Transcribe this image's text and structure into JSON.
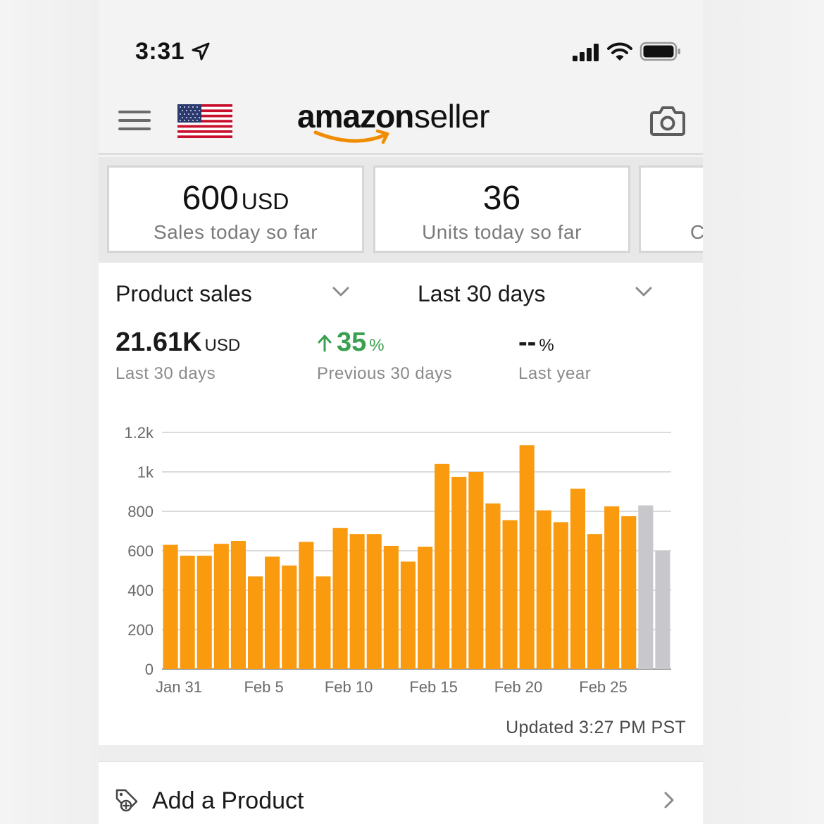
{
  "status_bar": {
    "time": "3:31"
  },
  "header": {
    "logo_amazon": "amazon",
    "logo_seller": "seller"
  },
  "cards": [
    {
      "value": "600",
      "unit": "USD",
      "label": "Sales today so far"
    },
    {
      "value": "36",
      "unit": "",
      "label": "Units today so far"
    },
    {
      "value": "",
      "unit": "",
      "label": "C"
    }
  ],
  "filters": {
    "metric": "Product sales",
    "period": "Last 30 days"
  },
  "stats": [
    {
      "value": "21.61K",
      "unit": "USD",
      "label": "Last 30 days"
    },
    {
      "value": "35",
      "unit": "%",
      "label": "Previous 30 days",
      "trend": "up"
    },
    {
      "value": "--",
      "unit": "%",
      "label": "Last year"
    }
  ],
  "chart_data": {
    "type": "bar",
    "y_ticks": [
      "1.2k",
      "1k",
      "800",
      "600",
      "400",
      "200",
      "0"
    ],
    "ylim": [
      0,
      1200
    ],
    "x_tick_labels": [
      {
        "index": 0,
        "label": "Jan 31"
      },
      {
        "index": 5,
        "label": "Feb 5"
      },
      {
        "index": 10,
        "label": "Feb 10"
      },
      {
        "index": 15,
        "label": "Feb 15"
      },
      {
        "index": 20,
        "label": "Feb 20"
      },
      {
        "index": 25,
        "label": "Feb 25"
      }
    ],
    "values": [
      630,
      575,
      575,
      635,
      650,
      470,
      570,
      525,
      645,
      470,
      715,
      685,
      685,
      625,
      545,
      620,
      1040,
      975,
      1000,
      840,
      755,
      1135,
      805,
      745,
      915,
      685,
      825,
      775,
      830,
      600
    ],
    "colors": {
      "actual": "#fa9a0e",
      "projected": "#c7c7cc"
    },
    "projected_from_index": 28,
    "grid": true
  },
  "updated_text": "Updated 3:27 PM PST",
  "add_product": {
    "label": "Add a Product"
  }
}
